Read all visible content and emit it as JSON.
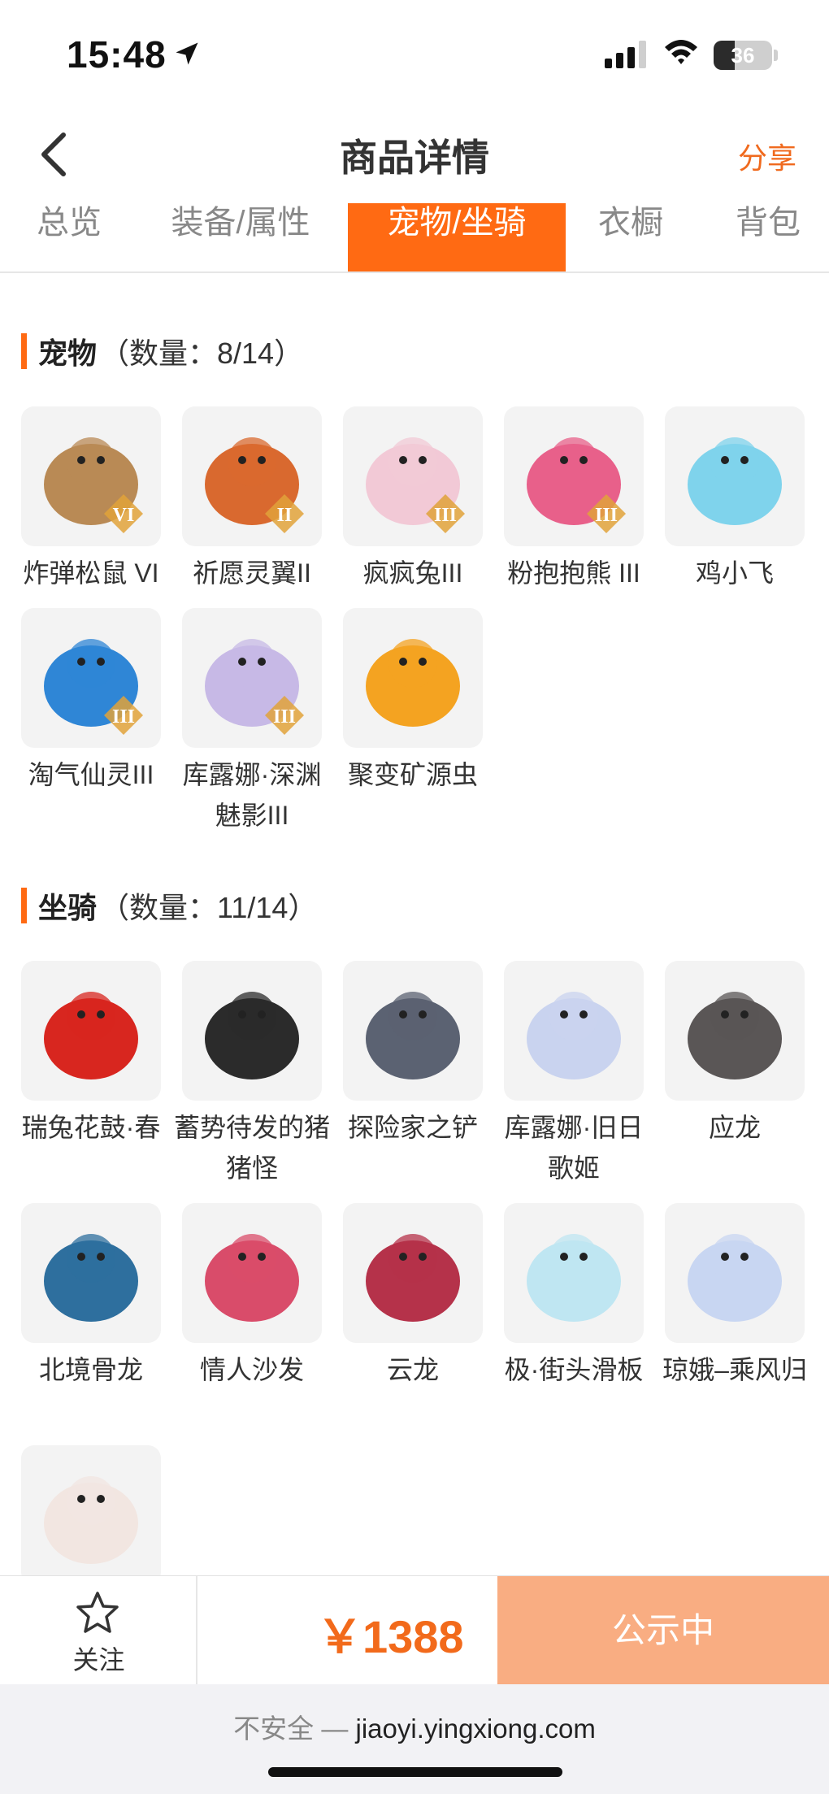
{
  "status_bar": {
    "time": "15:48",
    "battery": "36",
    "battery_level": 0.36
  },
  "nav": {
    "title": "商品详情",
    "share": "分享"
  },
  "tabs": [
    {
      "label": "总览"
    },
    {
      "label": "装备/属性"
    },
    {
      "label": "宠物/坐骑",
      "active": true
    },
    {
      "label": "衣橱"
    },
    {
      "label": "背包"
    }
  ],
  "pets": {
    "title": "宠物",
    "count": "（数量：8/14）",
    "items": [
      {
        "name": "炸弹松鼠 VI",
        "badge": "VI",
        "color": "#b98a55"
      },
      {
        "name": "祈愿灵翼II",
        "badge": "II",
        "color": "#d9692f"
      },
      {
        "name": "疯疯兔III",
        "badge": "III",
        "color": "#f2c9d6"
      },
      {
        "name": "粉抱抱熊 III",
        "badge": "III",
        "color": "#e8608a"
      },
      {
        "name": "鸡小飞",
        "badge": "",
        "color": "#7fd3ec"
      },
      {
        "name": "淘气仙灵III",
        "badge": "III",
        "color": "#2f86d6"
      },
      {
        "name": "库露娜·深渊魅影III",
        "badge": "III",
        "color": "#c7b9e6"
      },
      {
        "name": "聚变矿源虫",
        "badge": "",
        "color": "#f4a321"
      }
    ]
  },
  "mounts": {
    "title": "坐骑",
    "count": "（数量：11/14）",
    "items": [
      {
        "name": "瑞兔花鼓·春",
        "color": "#d8261f"
      },
      {
        "name": "蓄势待发的猪猪怪",
        "color": "#2b2b2b"
      },
      {
        "name": "探险家之铲",
        "color": "#5b6272"
      },
      {
        "name": "库露娜·旧日歌姬",
        "color": "#c9d3ef"
      },
      {
        "name": "应龙",
        "color": "#5a5656"
      },
      {
        "name": "北境骨龙",
        "color": "#2e6f9e"
      },
      {
        "name": "情人沙发",
        "color": "#d94c6a"
      },
      {
        "name": "云龙",
        "color": "#b5324a"
      },
      {
        "name": "极·街头滑板",
        "color": "#bfe6f2"
      },
      {
        "name": "琼娥–乘风归",
        "color": "#c8d6f2"
      },
      {
        "name": "",
        "color": "#f2e6e1"
      }
    ]
  },
  "bottom": {
    "follow": "关注",
    "price": "￥1388",
    "status": "公示中"
  },
  "url_bar": {
    "insecure": "不安全 — ",
    "domain": "jiaoyi.yingxiong.com"
  },
  "colors": {
    "accent": "#ff6a13",
    "price": "#f26a1b",
    "button": "#f9ad82"
  }
}
